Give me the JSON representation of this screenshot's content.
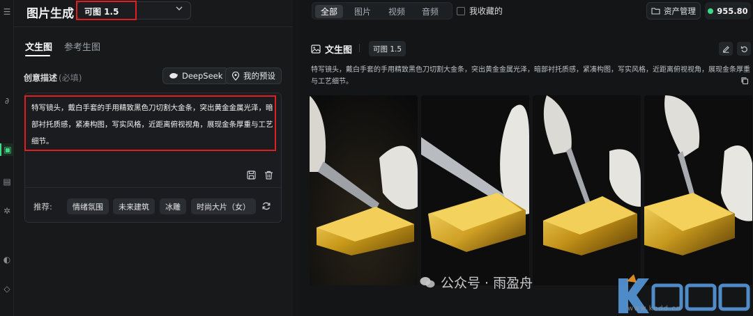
{
  "app": {
    "title": "图片生成",
    "model": "可图 1.5"
  },
  "tabs": [
    {
      "label": "文生图",
      "active": true
    },
    {
      "label": "参考生图",
      "active": false
    }
  ],
  "description": {
    "label": "创意描述",
    "required": "(必填)",
    "deepseek_label": "DeepSeek",
    "preset_label": "我的预设",
    "prompt_text": "特写镜头，戴白手套的手用精致黑色刀切割大金条，突出黄金金属光泽，暗部衬托质感，紧凑构图，写实风格，近距离俯视视角，展现金条厚重与工艺细节。"
  },
  "recommend": {
    "label": "推荐:",
    "chips": [
      "情绪氛围",
      "未来建筑",
      "冰雕",
      "时尚大片（女）"
    ]
  },
  "filter": {
    "segments": [
      {
        "label": "全部",
        "active": true
      },
      {
        "label": "图片",
        "active": false
      },
      {
        "label": "视频",
        "active": false
      },
      {
        "label": "音频",
        "active": false
      }
    ],
    "favorites_label": "我收藏的"
  },
  "header_right": {
    "asset_label": "资产管理",
    "credits": "955.80"
  },
  "result": {
    "mode": "文生图",
    "model": "可图 1.5",
    "prompt": "特写镜头，戴白手套的手用精致黑色刀切割大金条，突出黄金金属光泽，暗部衬托质感，紧凑构图，写实风格，近距离俯视视角，展现金条厚重与工艺细节。"
  },
  "watermark": {
    "text": "公众号 · 雨盈舟",
    "logo_text": "K课多多",
    "url": "www.kedd.cn"
  },
  "colors": {
    "accent": "#3ddc84",
    "highlight_border": "#e02020",
    "gold": "#c99a1a"
  }
}
